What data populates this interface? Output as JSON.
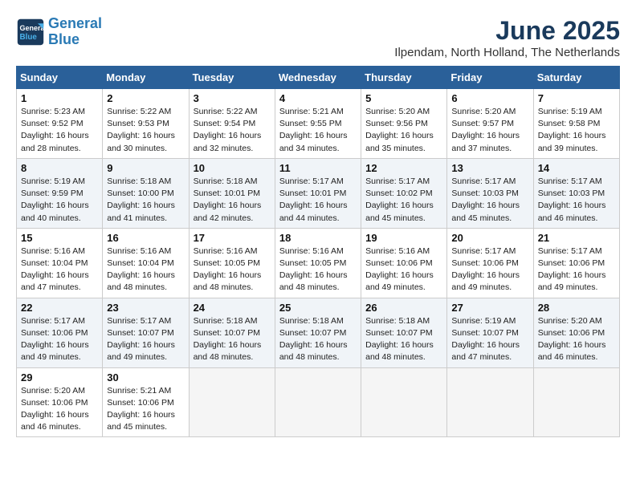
{
  "header": {
    "logo_line1": "General",
    "logo_line2": "Blue",
    "title": "June 2025",
    "subtitle": "Ilpendam, North Holland, The Netherlands"
  },
  "days_of_week": [
    "Sunday",
    "Monday",
    "Tuesday",
    "Wednesday",
    "Thursday",
    "Friday",
    "Saturday"
  ],
  "weeks": [
    [
      {
        "day": "1",
        "info": "Sunrise: 5:23 AM\nSunset: 9:52 PM\nDaylight: 16 hours\nand 28 minutes."
      },
      {
        "day": "2",
        "info": "Sunrise: 5:22 AM\nSunset: 9:53 PM\nDaylight: 16 hours\nand 30 minutes."
      },
      {
        "day": "3",
        "info": "Sunrise: 5:22 AM\nSunset: 9:54 PM\nDaylight: 16 hours\nand 32 minutes."
      },
      {
        "day": "4",
        "info": "Sunrise: 5:21 AM\nSunset: 9:55 PM\nDaylight: 16 hours\nand 34 minutes."
      },
      {
        "day": "5",
        "info": "Sunrise: 5:20 AM\nSunset: 9:56 PM\nDaylight: 16 hours\nand 35 minutes."
      },
      {
        "day": "6",
        "info": "Sunrise: 5:20 AM\nSunset: 9:57 PM\nDaylight: 16 hours\nand 37 minutes."
      },
      {
        "day": "7",
        "info": "Sunrise: 5:19 AM\nSunset: 9:58 PM\nDaylight: 16 hours\nand 39 minutes."
      }
    ],
    [
      {
        "day": "8",
        "info": "Sunrise: 5:19 AM\nSunset: 9:59 PM\nDaylight: 16 hours\nand 40 minutes."
      },
      {
        "day": "9",
        "info": "Sunrise: 5:18 AM\nSunset: 10:00 PM\nDaylight: 16 hours\nand 41 minutes."
      },
      {
        "day": "10",
        "info": "Sunrise: 5:18 AM\nSunset: 10:01 PM\nDaylight: 16 hours\nand 42 minutes."
      },
      {
        "day": "11",
        "info": "Sunrise: 5:17 AM\nSunset: 10:01 PM\nDaylight: 16 hours\nand 44 minutes."
      },
      {
        "day": "12",
        "info": "Sunrise: 5:17 AM\nSunset: 10:02 PM\nDaylight: 16 hours\nand 45 minutes."
      },
      {
        "day": "13",
        "info": "Sunrise: 5:17 AM\nSunset: 10:03 PM\nDaylight: 16 hours\nand 45 minutes."
      },
      {
        "day": "14",
        "info": "Sunrise: 5:17 AM\nSunset: 10:03 PM\nDaylight: 16 hours\nand 46 minutes."
      }
    ],
    [
      {
        "day": "15",
        "info": "Sunrise: 5:16 AM\nSunset: 10:04 PM\nDaylight: 16 hours\nand 47 minutes."
      },
      {
        "day": "16",
        "info": "Sunrise: 5:16 AM\nSunset: 10:04 PM\nDaylight: 16 hours\nand 48 minutes."
      },
      {
        "day": "17",
        "info": "Sunrise: 5:16 AM\nSunset: 10:05 PM\nDaylight: 16 hours\nand 48 minutes."
      },
      {
        "day": "18",
        "info": "Sunrise: 5:16 AM\nSunset: 10:05 PM\nDaylight: 16 hours\nand 48 minutes."
      },
      {
        "day": "19",
        "info": "Sunrise: 5:16 AM\nSunset: 10:06 PM\nDaylight: 16 hours\nand 49 minutes."
      },
      {
        "day": "20",
        "info": "Sunrise: 5:17 AM\nSunset: 10:06 PM\nDaylight: 16 hours\nand 49 minutes."
      },
      {
        "day": "21",
        "info": "Sunrise: 5:17 AM\nSunset: 10:06 PM\nDaylight: 16 hours\nand 49 minutes."
      }
    ],
    [
      {
        "day": "22",
        "info": "Sunrise: 5:17 AM\nSunset: 10:06 PM\nDaylight: 16 hours\nand 49 minutes."
      },
      {
        "day": "23",
        "info": "Sunrise: 5:17 AM\nSunset: 10:07 PM\nDaylight: 16 hours\nand 49 minutes."
      },
      {
        "day": "24",
        "info": "Sunrise: 5:18 AM\nSunset: 10:07 PM\nDaylight: 16 hours\nand 48 minutes."
      },
      {
        "day": "25",
        "info": "Sunrise: 5:18 AM\nSunset: 10:07 PM\nDaylight: 16 hours\nand 48 minutes."
      },
      {
        "day": "26",
        "info": "Sunrise: 5:18 AM\nSunset: 10:07 PM\nDaylight: 16 hours\nand 48 minutes."
      },
      {
        "day": "27",
        "info": "Sunrise: 5:19 AM\nSunset: 10:07 PM\nDaylight: 16 hours\nand 47 minutes."
      },
      {
        "day": "28",
        "info": "Sunrise: 5:20 AM\nSunset: 10:06 PM\nDaylight: 16 hours\nand 46 minutes."
      }
    ],
    [
      {
        "day": "29",
        "info": "Sunrise: 5:20 AM\nSunset: 10:06 PM\nDaylight: 16 hours\nand 46 minutes."
      },
      {
        "day": "30",
        "info": "Sunrise: 5:21 AM\nSunset: 10:06 PM\nDaylight: 16 hours\nand 45 minutes."
      },
      null,
      null,
      null,
      null,
      null
    ]
  ]
}
